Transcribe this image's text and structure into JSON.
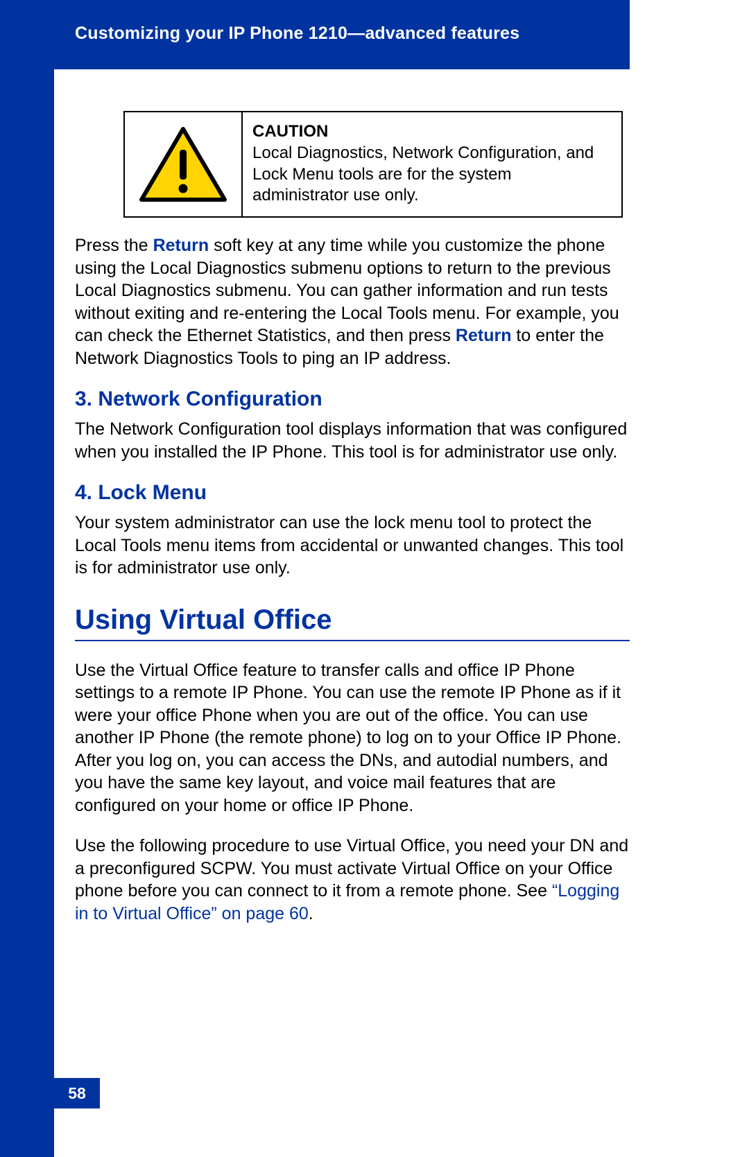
{
  "header": {
    "running_title": "Customizing your IP Phone 1210—advanced features"
  },
  "caution": {
    "title": "CAUTION",
    "text": "Local Diagnostics, Network Configuration, and Lock Menu tools are for the system administrator use only."
  },
  "para1": {
    "part1": "Press the ",
    "link1": "Return",
    "part2": " soft key at any time while you customize the phone using the Local Diagnostics submenu options to return to the previous Local Diagnostics submenu. You can gather information and run tests without exiting and re-entering the Local Tools menu. For example, you can check the Ethernet Statistics, and then press ",
    "link2": "Return",
    "part3": " to enter the Network Diagnostics Tools to ping an IP address."
  },
  "section_netconf": {
    "heading": "3. Network Configuration",
    "body": "The Network Configuration tool displays information that was configured when you installed the IP Phone. This tool is for administrator use only."
  },
  "section_lockmenu": {
    "heading": "4. Lock Menu",
    "body": "Your system administrator can use the lock menu tool to protect the Local Tools menu items from accidental or unwanted changes. This tool is for administrator use only."
  },
  "section_vo": {
    "heading": "Using Virtual Office",
    "para1": "Use the Virtual Office feature to transfer calls and office IP Phone settings to a remote IP Phone. You can use the remote IP Phone as if it were your office Phone when you are out of the office. You can use another IP Phone (the remote phone) to log on to your Office IP Phone. After you log on, you can access the DNs, and autodial numbers, and you have the same key layout, and voice mail features that are configured on your home or office IP Phone.",
    "para2_part1": "Use the following procedure to use Virtual Office, you need your DN and a preconfigured SCPW. You must activate Virtual Office on your Office phone before you can connect to it from a remote phone. See ",
    "para2_xref": "“Logging in to Virtual Office” on page 60",
    "para2_part2": "."
  },
  "page_number": "58"
}
